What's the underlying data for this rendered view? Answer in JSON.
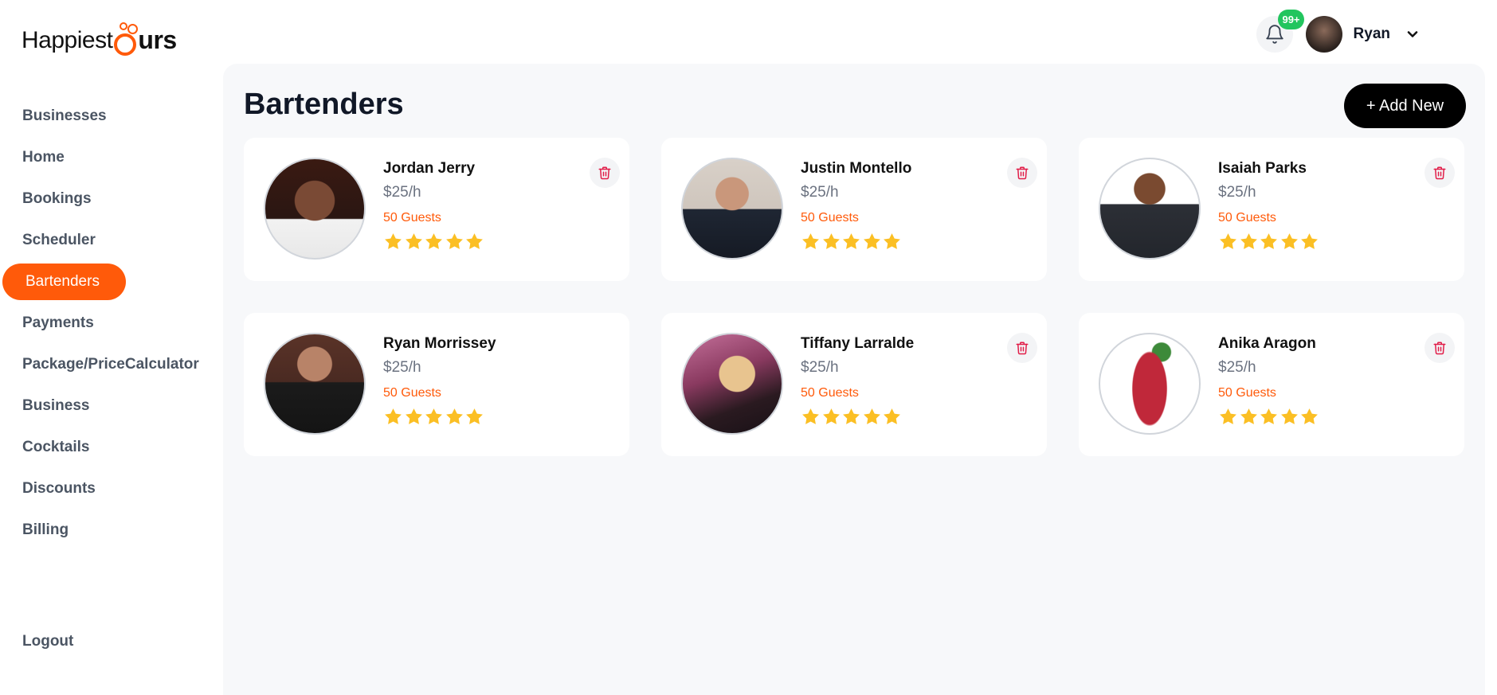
{
  "brand": {
    "name_prefix": "Happiest",
    "name_suffix": "urs",
    "accent": "#ff5a0a"
  },
  "header": {
    "notification_count": "99+",
    "user_name": "Ryan",
    "icons": {
      "bell": "bell-icon",
      "dropdown": "chevron-down-icon"
    }
  },
  "sidebar": {
    "items": [
      {
        "label": "Businesses"
      },
      {
        "label": "Home"
      },
      {
        "label": "Bookings"
      },
      {
        "label": "Scheduler"
      },
      {
        "label": "Bartenders",
        "active": true
      },
      {
        "label": "Payments"
      },
      {
        "label": "Package/PriceCalculator"
      },
      {
        "label": "Business"
      },
      {
        "label": "Cocktails"
      },
      {
        "label": "Discounts"
      },
      {
        "label": "Billing"
      }
    ],
    "logout": "Logout"
  },
  "main": {
    "title": "Bartenders",
    "add_button": "+ Add New",
    "bartenders": [
      {
        "name": "Jordan Jerry",
        "rate": "$25/h",
        "guests": "50 Guests",
        "rating": 5
      },
      {
        "name": "Justin Montello",
        "rate": "$25/h",
        "guests": "50 Guests",
        "rating": 5
      },
      {
        "name": "Isaiah Parks",
        "rate": "$25/h",
        "guests": "50 Guests",
        "rating": 5
      },
      {
        "name": "Ryan Morrissey",
        "rate": "$25/h",
        "guests": "50 Guests",
        "rating": 5
      },
      {
        "name": "Tiffany Larralde",
        "rate": "$25/h",
        "guests": "50 Guests",
        "rating": 5
      },
      {
        "name": "Anika Aragon",
        "rate": "$25/h",
        "guests": "50 Guests",
        "rating": 5
      }
    ]
  },
  "colors": {
    "star": "#fbbf24",
    "delete": "#e11d48",
    "badge": "#22c55e"
  }
}
